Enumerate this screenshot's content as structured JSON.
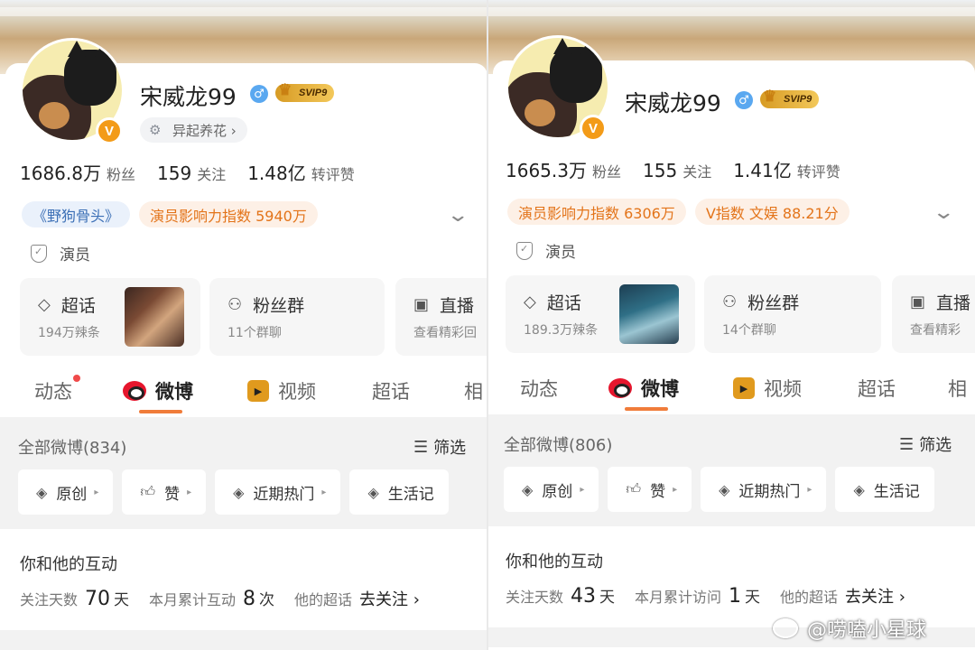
{
  "colors": {
    "accent_orange": "#f07c3a",
    "pill_blue_text": "#3b6fb6",
    "pill_orange_text": "#e3741a",
    "verified_badge": "#f39b18",
    "weibo_red": "#e6162d"
  },
  "panels": [
    {
      "profile": {
        "name": "宋威龙99",
        "vip_badge": "SVIP9",
        "verified_mark": "V",
        "group_tag": "异起养花 ›"
      },
      "stats": [
        {
          "value": "1686.8万",
          "label": "粉丝"
        },
        {
          "value": "159",
          "label": "关注"
        },
        {
          "value": "1.48亿",
          "label": "转评赞"
        }
      ],
      "pills": [
        {
          "text": "《野狗骨头》",
          "style": "blue"
        },
        {
          "text": "演员影响力指数 5940万",
          "style": "orange"
        }
      ],
      "role": "演员",
      "features": [
        {
          "title": "超话",
          "subtitle": "194万辣条",
          "icon": "diamond-icon"
        },
        {
          "title": "粉丝群",
          "subtitle": "11个群聊",
          "icon": "group-icon"
        },
        {
          "title": "直播",
          "subtitle": "查看精彩回",
          "icon": "tv-icon"
        }
      ],
      "tabs": [
        "动态",
        "微博",
        "视频",
        "超话",
        "相"
      ],
      "active_tab": "微博",
      "weibo_count_label": "全部微博(834)",
      "filter_label": "筛选",
      "chips": [
        "原创",
        "赞",
        "近期热门",
        "生活记"
      ],
      "interaction": {
        "title": "你和他的互动",
        "follow_days_label": "关注天数",
        "follow_days_value": "70",
        "follow_days_unit": "天",
        "month_label": "本月累计互动",
        "month_value": "8",
        "month_unit": "次",
        "supertopic_label": "他的超话",
        "action": "去关注 ›"
      }
    },
    {
      "profile": {
        "name": "宋威龙99",
        "vip_badge": "SVIP9",
        "verified_mark": "V"
      },
      "stats": [
        {
          "value": "1665.3万",
          "label": "粉丝"
        },
        {
          "value": "155",
          "label": "关注"
        },
        {
          "value": "1.41亿",
          "label": "转评赞"
        }
      ],
      "pills": [
        {
          "text": "演员影响力指数 6306万",
          "style": "orange"
        },
        {
          "text": "V指数 文娱 88.21分",
          "style": "orange"
        }
      ],
      "role": "演员",
      "features": [
        {
          "title": "超话",
          "subtitle": "189.3万辣条",
          "icon": "diamond-icon"
        },
        {
          "title": "粉丝群",
          "subtitle": "14个群聊",
          "icon": "group-icon"
        },
        {
          "title": "直播",
          "subtitle": "查看精彩",
          "icon": "tv-icon"
        }
      ],
      "tabs": [
        "动态",
        "微博",
        "视频",
        "超话",
        "相"
      ],
      "active_tab": "微博",
      "weibo_count_label": "全部微博(806)",
      "filter_label": "筛选",
      "chips": [
        "原创",
        "赞",
        "近期热门",
        "生活记"
      ],
      "interaction": {
        "title": "你和他的互动",
        "follow_days_label": "关注天数",
        "follow_days_value": "43",
        "follow_days_unit": "天",
        "month_label": "本月累计访问",
        "month_value": "1",
        "month_unit": "天",
        "supertopic_label": "他的超话",
        "action": "去关注 ›"
      }
    }
  ],
  "watermark": "@唠嗑小星球"
}
